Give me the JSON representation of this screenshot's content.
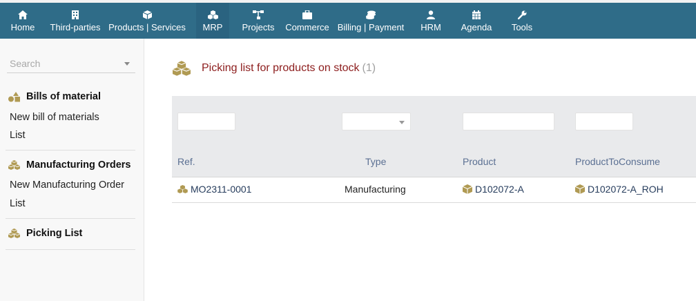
{
  "nav": {
    "items": [
      {
        "label": "Home",
        "icon": "home-icon"
      },
      {
        "label": "Third-parties",
        "icon": "building-icon"
      },
      {
        "label": "Products | Services",
        "icon": "cube-icon"
      },
      {
        "label": "MRP",
        "icon": "cubes-icon",
        "active": true
      },
      {
        "label": "Projects",
        "icon": "sitemap-icon"
      },
      {
        "label": "Commerce",
        "icon": "briefcase-icon"
      },
      {
        "label": "Billing | Payment",
        "icon": "coins-icon"
      },
      {
        "label": "HRM",
        "icon": "user-icon"
      },
      {
        "label": "Agenda",
        "icon": "calendar-icon"
      },
      {
        "label": "Tools",
        "icon": "wrench-icon"
      }
    ]
  },
  "sidebar": {
    "search_placeholder": "Search",
    "sections": [
      {
        "title": "Bills of material",
        "icon": "shapes-icon",
        "links": [
          "New bill of materials",
          "List"
        ]
      },
      {
        "title": "Manufacturing Orders",
        "icon": "cubes-icon",
        "links": [
          "New Manufacturing Order",
          "List"
        ]
      },
      {
        "title": "Picking List",
        "icon": "cubes-icon",
        "links": []
      }
    ]
  },
  "main": {
    "title": "Picking list for products on stock",
    "count": "(1)",
    "columns": [
      "Ref.",
      "Type",
      "Product",
      "ProductToConsume"
    ],
    "rows": [
      {
        "ref": "MO2311-0001",
        "type": "Manufacturing",
        "product": "D102072-A",
        "product_to_consume": "D102072-A_ROH"
      }
    ]
  },
  "colors": {
    "topbar": "#2f6c88",
    "title": "#8c1c1c",
    "accent_icon": "#b09a53",
    "table_header_bg": "#e9eaec"
  }
}
